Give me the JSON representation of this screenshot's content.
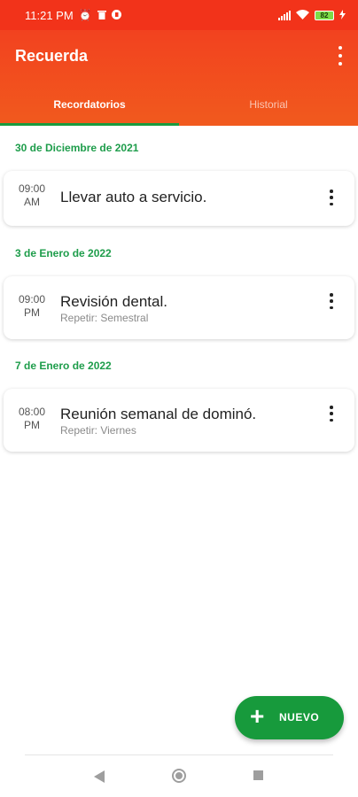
{
  "status_bar": {
    "time": "11:21 PM",
    "icons": [
      "alarm-icon",
      "trash-icon",
      "app-notification-icon",
      "signal-icon",
      "wifi-icon",
      "charging-icon"
    ],
    "battery": "82"
  },
  "app_bar": {
    "title": "Recuerda",
    "tabs": [
      {
        "label": "Recordatorios",
        "active": true
      },
      {
        "label": "Historial",
        "active": false
      }
    ]
  },
  "groups": [
    {
      "date": "30 de Diciembre de 2021",
      "items": [
        {
          "time": "09:00",
          "period": "AM",
          "title": "Llevar auto a servicio.",
          "repeat": ""
        }
      ]
    },
    {
      "date": "3 de Enero de 2022",
      "items": [
        {
          "time": "09:00",
          "period": "PM",
          "title": "Revisión dental.",
          "repeat": "Repetir: Semestral"
        }
      ]
    },
    {
      "date": "7 de Enero de 2022",
      "items": [
        {
          "time": "08:00",
          "period": "PM",
          "title": "Reunión semanal de dominó.",
          "repeat": "Repetir: Viernes"
        }
      ]
    }
  ],
  "fab": {
    "icon": "plus-icon",
    "label": "NUEVO"
  },
  "colors": {
    "status_bar": "#f2331a",
    "app_bar": "#f15a1e",
    "accent": "#1e9d4b",
    "fab": "#179a3c"
  }
}
